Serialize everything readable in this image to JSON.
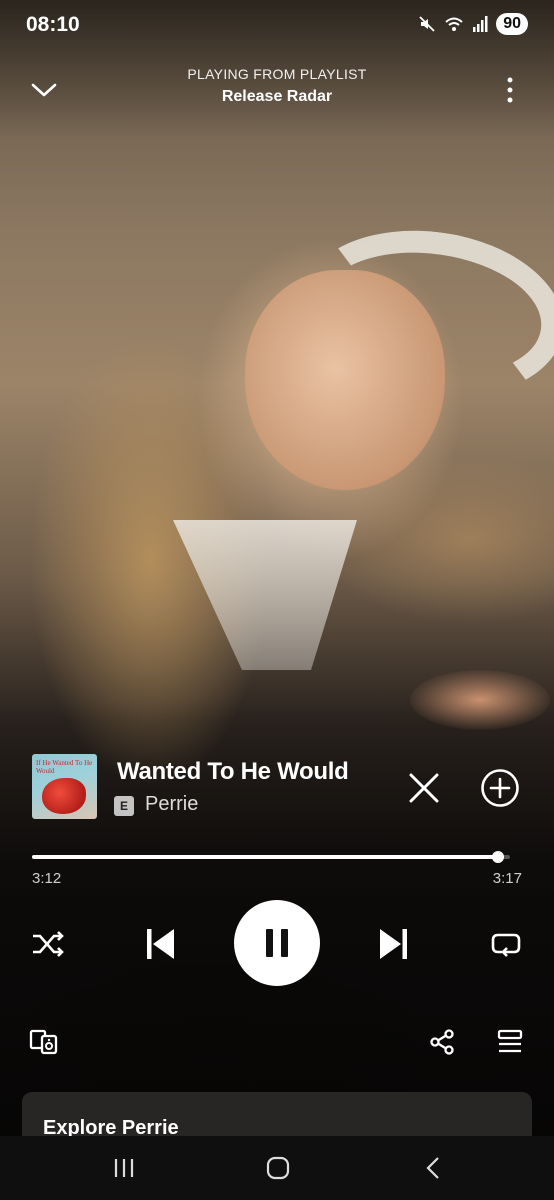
{
  "status_bar": {
    "time": "08:10",
    "battery": "90",
    "icons": [
      "mute-icon",
      "wifi-icon",
      "signal-icon",
      "battery-icon"
    ]
  },
  "header": {
    "context_label": "PLAYING FROM PLAYLIST",
    "context_name": "Release Radar",
    "icons": [
      "chevron-down-icon",
      "more-vertical-icon"
    ]
  },
  "track": {
    "title": "Wanted To He Would",
    "artist": "Perrie",
    "explicit_badge": "E",
    "cover_text": "If He Wanted To He Would"
  },
  "playback": {
    "elapsed": "3:12",
    "duration": "3:17",
    "progress_fraction": 0.975,
    "state": "playing"
  },
  "controls": [
    "shuffle-icon",
    "previous-icon",
    "pause-icon",
    "next-icon",
    "repeat-icon"
  ],
  "bottom_actions": [
    "connect-device-icon",
    "share-icon",
    "queue-icon"
  ],
  "explore": {
    "title": "Explore Perrie"
  },
  "nav_bar": [
    "recents-icon",
    "home-icon",
    "back-icon"
  ],
  "colors": {
    "accent": "#ffffff",
    "card_background": "#2a2826",
    "nav_background": "#0f0f0f"
  }
}
